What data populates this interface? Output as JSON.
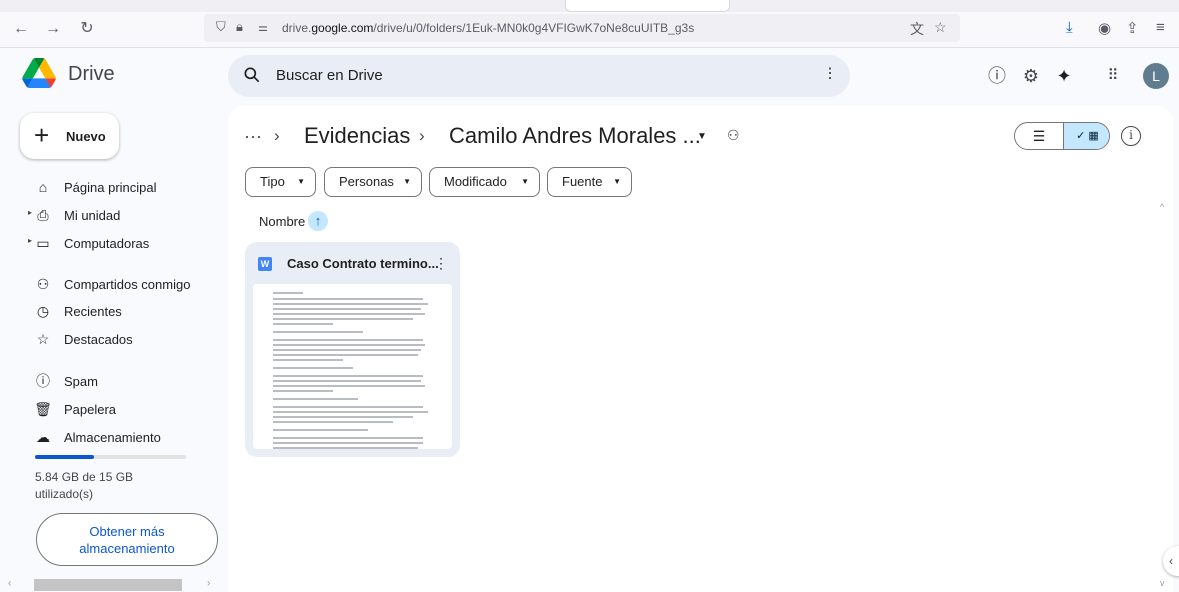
{
  "browser": {
    "url_prefix": "drive.",
    "url_domain": "google.com",
    "url_path": "/drive/u/0/folders/1Euk-MN0k0g4VFIGwK7oNe8cuUITB_g3s",
    "icons": [
      "back-icon",
      "forward-icon",
      "reload-icon",
      "shield-icon",
      "lock-icon",
      "permissions-icon",
      "translate-icon",
      "bookmark-star-icon",
      "downloads-icon",
      "account-icon",
      "extensions-icon",
      "menu-icon"
    ]
  },
  "header": {
    "app_name": "Drive",
    "search_placeholder": "Buscar en Drive",
    "avatar_initial": "L",
    "icons": [
      "help-icon",
      "settings-icon",
      "gemini-icon",
      "apps-grid-icon"
    ]
  },
  "sidebar": {
    "new_label": "Nuevo",
    "items": [
      {
        "label": "Página principal",
        "icon": "home-icon"
      },
      {
        "label": "Mi unidad",
        "icon": "drive-icon"
      },
      {
        "label": "Computadoras",
        "icon": "computers-icon"
      },
      {
        "label": "Compartidos conmigo",
        "icon": "shared-icon"
      },
      {
        "label": "Recientes",
        "icon": "clock-icon"
      },
      {
        "label": "Destacados",
        "icon": "star-icon"
      },
      {
        "label": "Spam",
        "icon": "spam-icon"
      },
      {
        "label": "Papelera",
        "icon": "trash-icon"
      },
      {
        "label": "Almacenamiento",
        "icon": "cloud-icon"
      }
    ],
    "storage_line1": "5.84 GB de 15 GB",
    "storage_line2": "utilizado(s)",
    "storage_used_fraction": 0.39,
    "more_storage_line1": "Obtener más",
    "more_storage_line2": "almacenamiento"
  },
  "main": {
    "breadcrumb_more": "···",
    "breadcrumb_parent": "Evidencias",
    "breadcrumb_current": "Camilo Andres Morales ...",
    "filters": [
      "Tipo",
      "Personas",
      "Modificado",
      "Fuente"
    ],
    "sort_label": "Nombre",
    "files": [
      {
        "name": "Caso Contrato termino...",
        "type_icon": "word-doc-icon"
      }
    ]
  },
  "colors": {
    "accent": "#0b57d0",
    "selected": "#c2e7ff",
    "card_bg": "#e9eef6",
    "search_bg": "#e9eef6"
  }
}
